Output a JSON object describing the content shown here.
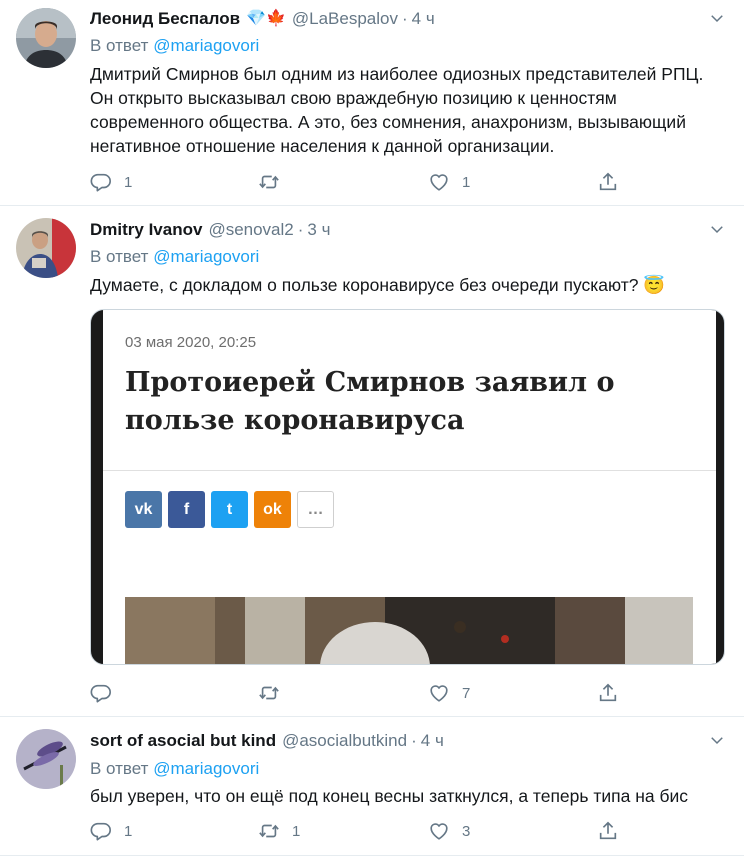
{
  "colors": {
    "link": "#1da1f2",
    "muted": "#657786",
    "divider": "#e6ecf0"
  },
  "tweets": [
    {
      "name": "Леонид Беспалов",
      "badges": "💎🍁",
      "handle": "@LaBespalov",
      "sep": "·",
      "time": "4 ч",
      "reply_prefix": "В ответ",
      "reply_to": "@mariagovori",
      "text": "Дмитрий Смирнов был одним из наиболее одиозных представителей РПЦ. Он открыто высказывал свою враждебную позицию к ценностям современного общества. А это, без сомнения, анахронизм, вызывающий негативное отношение населения к данной организации.",
      "replies": "1",
      "retweets": "",
      "likes": "1"
    },
    {
      "name": "Dmitry Ivanov",
      "handle": "@senoval2",
      "sep": "·",
      "time": "3 ч",
      "reply_prefix": "В ответ",
      "reply_to": "@mariagovori",
      "text": "Думаете, с докладом о пользе коронавирусе без очереди пускают? 😇",
      "replies": "",
      "retweets": "",
      "likes": "7",
      "card": {
        "date": "03 мая 2020, 20:25",
        "title": "Протоиерей Смирнов заявил о пользе коронавируса",
        "share_buttons": [
          {
            "icon": "vk-icon",
            "label": "vk",
            "color": "#4a76a8"
          },
          {
            "icon": "facebook-icon",
            "label": "f",
            "color": "#3b5998"
          },
          {
            "icon": "twitter-icon",
            "label": "t",
            "color": "#1da1f2"
          },
          {
            "icon": "odnoklassniki-icon",
            "label": "ok",
            "color": "#ee8208"
          },
          {
            "icon": "more-icon",
            "label": "…",
            "color": "#ffffff"
          }
        ]
      }
    },
    {
      "name": "sort of asocial but kind",
      "handle": "@asocialbutkind",
      "sep": "·",
      "time": "4 ч",
      "reply_prefix": "В ответ",
      "reply_to": "@mariagovori",
      "text": "был уверен, что он ещё под конец весны заткнулся, а теперь типа на бис",
      "replies": "1",
      "retweets": "1",
      "likes": "3"
    }
  ]
}
